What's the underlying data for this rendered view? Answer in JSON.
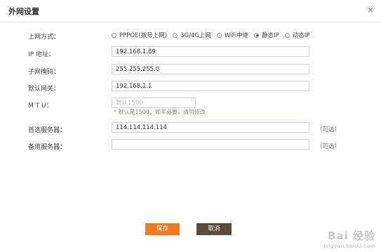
{
  "dialog": {
    "title": "外网设置",
    "close_glyph": "×"
  },
  "connection": {
    "label": "上网方式：",
    "options": [
      {
        "label": "PPPOE(拨号上网)",
        "checked": false
      },
      {
        "label": "3G/4G上网",
        "checked": false
      },
      {
        "label": "WiFi中继",
        "checked": false
      },
      {
        "label": "静态IP",
        "checked": true
      },
      {
        "label": "动态IP",
        "checked": false
      }
    ]
  },
  "fields": {
    "ip": {
      "label": "IP 地址：",
      "value": "192.168.1.89"
    },
    "mask": {
      "label": "子网掩码：",
      "value": "255.255.255.0"
    },
    "gateway": {
      "label": "默认网关：",
      "value": "192.168.1.1"
    },
    "mtu": {
      "label": "M T U：",
      "value": "",
      "placeholder": "默认1500",
      "hint": "* 默认是1500，如非必要，请勿修改"
    },
    "dns1": {
      "label": "首选服务器：",
      "value": "114.114.114.114",
      "suffix": "（可选）"
    },
    "dns2": {
      "label": "备用服务器：",
      "value": "",
      "suffix": "（可选）"
    }
  },
  "buttons": {
    "save": "保存",
    "cancel": "取消"
  },
  "watermark": {
    "logo": "Bai 经验",
    "url": "jingyan.baidu.com"
  },
  "colors": {
    "save_button": "#f47a1f",
    "cancel_button": "#5a4d40",
    "input_border": "#c7d7e6"
  }
}
